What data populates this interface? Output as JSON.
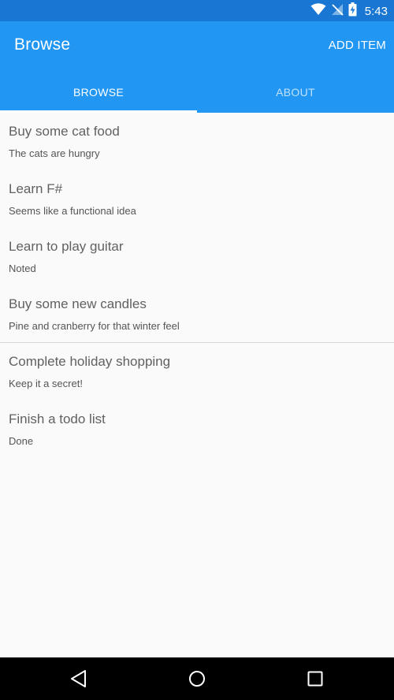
{
  "status_bar": {
    "time": "5:43",
    "icons": [
      "wifi-icon",
      "no-signal-icon",
      "battery-charging-icon"
    ]
  },
  "app_bar": {
    "title": "Browse",
    "add_item_label": "ADD ITEM"
  },
  "tabs": [
    {
      "label": "BROWSE",
      "active": true
    },
    {
      "label": "ABOUT",
      "active": false
    }
  ],
  "items": [
    {
      "title": "Buy some cat food",
      "description": "The cats are hungry"
    },
    {
      "title": "Learn F#",
      "description": "Seems like a functional idea"
    },
    {
      "title": "Learn to play guitar",
      "description": "Noted"
    },
    {
      "title": "Buy some new candles",
      "description": "Pine and cranberry for that winter feel"
    },
    {
      "title": "Complete holiday shopping",
      "description": "Keep it a secret!"
    },
    {
      "title": "Finish a todo list",
      "description": "Done"
    }
  ],
  "nav_bar": {
    "buttons": [
      "back-icon",
      "home-icon",
      "recents-icon"
    ]
  },
  "colors": {
    "primary": "#2196f3",
    "primary_dark": "#1976d2",
    "background": "#fafafa"
  }
}
